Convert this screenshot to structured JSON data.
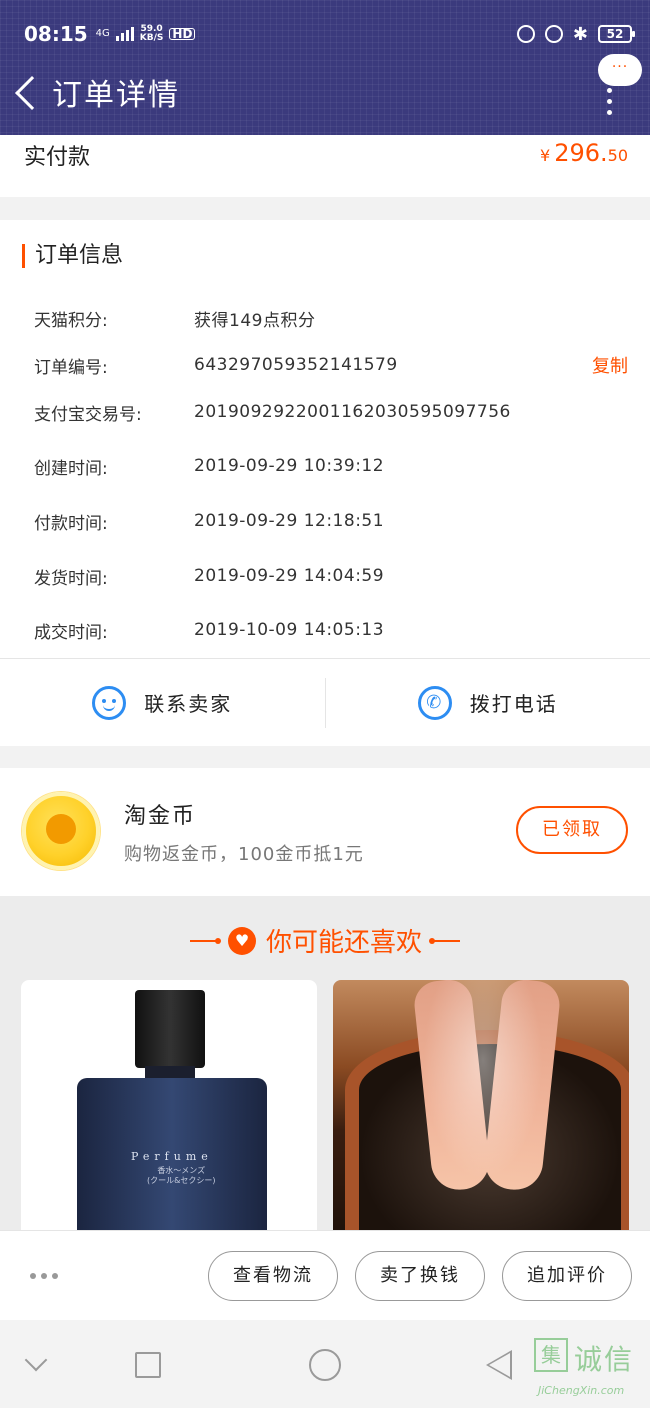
{
  "status_bar": {
    "time": "08:15",
    "network": "4G",
    "speed_value": "59.0",
    "speed_unit": "KB/S",
    "hd": "HD",
    "battery": "52"
  },
  "header": {
    "title": "订单详情",
    "more_bubble": "···"
  },
  "payment": {
    "label": "实付款",
    "currency": "¥",
    "amount_int": "296.",
    "amount_dec": "50"
  },
  "order_info": {
    "title": "订单信息",
    "rows": [
      {
        "label": "天猫积分:",
        "value": "获得149点积分"
      },
      {
        "label": "订单编号:",
        "value": "643297059352141579",
        "action": "复制"
      },
      {
        "label": "支付宝交易号:",
        "value": "2019092922001162030595097756"
      },
      {
        "label": "创建时间:",
        "value": "2019-09-29 10:39:12"
      },
      {
        "label": "付款时间:",
        "value": "2019-09-29 12:18:51"
      },
      {
        "label": "发货时间:",
        "value": "2019-09-29 14:04:59"
      },
      {
        "label": "成交时间:",
        "value": "2019-10-09 14:05:13"
      }
    ],
    "contact_seller": "联系卖家",
    "call_phone": "拨打电话"
  },
  "coins": {
    "title": "淘金币",
    "subtitle": "购物返金币，100金币抵1元",
    "button": "已领取"
  },
  "recommend": {
    "title": "你可能还喜欢",
    "products": [
      {
        "label": "Perfume",
        "sub1": "香水〜メンズ",
        "sub2": "(クール&セクシー)"
      },
      {
        "label": ""
      }
    ]
  },
  "actions": {
    "logistics": "查看物流",
    "resell": "卖了换钱",
    "review": "追加评价"
  },
  "watermark": {
    "box": "集",
    "text": "诚信",
    "url": "JiChengXin.com"
  },
  "colors": {
    "accent": "#ff5000",
    "header_bg": "#3b3a7d",
    "icon_blue": "#2d8df2"
  }
}
